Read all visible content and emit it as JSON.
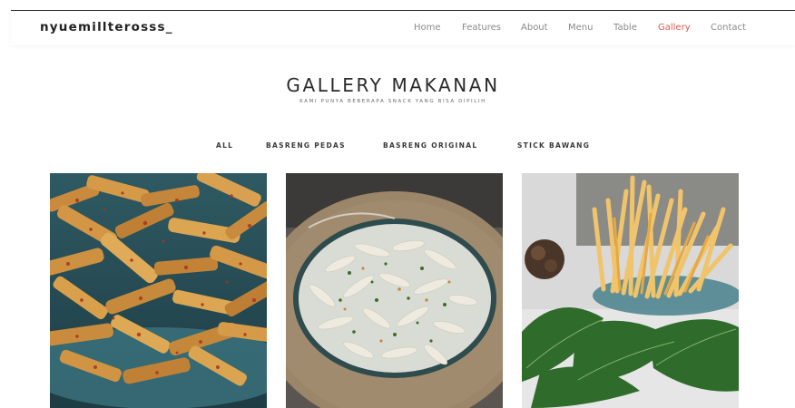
{
  "brand": "nyuemillterosss_",
  "nav": {
    "items": [
      {
        "label": "Home",
        "active": false
      },
      {
        "label": "Features",
        "active": false
      },
      {
        "label": "About",
        "active": false
      },
      {
        "label": "Menu",
        "active": false
      },
      {
        "label": "Table",
        "active": false
      },
      {
        "label": "Gallery",
        "active": true
      },
      {
        "label": "Contact",
        "active": false
      }
    ]
  },
  "section": {
    "title": "GALLERY MAKANAN",
    "subtitle": "KAMI PUNYA BEBERAPA SNACK YANG BISA DIPILIH"
  },
  "filters": [
    "ALL",
    "BASRENG PEDAS",
    "BASRENG ORIGINAL",
    "STICK BAWANG"
  ],
  "colors": {
    "accent": "#e0584f",
    "nav_text": "#8a8a8a",
    "heading": "#2a2a2a"
  },
  "gallery": [
    {
      "icon": "basreng-pedas-photo"
    },
    {
      "icon": "basreng-original-photo"
    },
    {
      "icon": "stick-bawang-photo"
    }
  ]
}
